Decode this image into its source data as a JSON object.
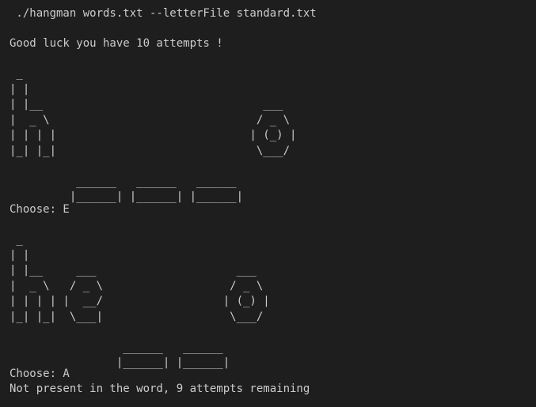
{
  "terminal": {
    "command": " ./hangman words.txt --letterFile standard.txt",
    "welcome": "Good luck you have 10 attempts !",
    "block1": " _\n| |\n| |__                                 ___\n|  _ \\                               / _ \\\n| | | |                             | (_) |\n|_| |_|                              \\___/\n\n          ______   ______   ______\n         |______| |______| |______|",
    "prompt1": "Choose: E",
    "block2": " _\n| |\n| |__     ___                     ___\n|  _ \\   / _ \\                   / _ \\\n| | | | |  __/                  | (_) |\n|_| |_|  \\___|                   \\___/\n\n                 ______   ______\n                |______| |______|",
    "prompt2": "Choose: A",
    "result": "Not present in the word, 9 attempts remaining"
  },
  "colors": {
    "background": "#1e1e1e",
    "text": "#cccccc"
  }
}
